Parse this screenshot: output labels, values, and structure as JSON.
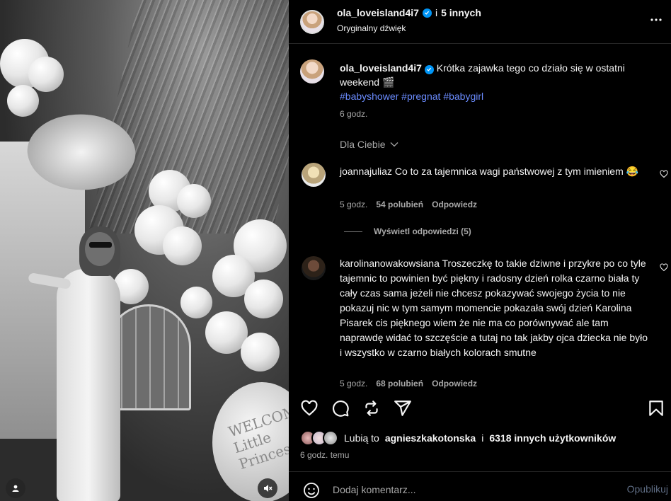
{
  "header": {
    "username": "ola_loveisland4i7",
    "collab_connector": "i",
    "collab_others": "5 innych",
    "audio": "Oryginalny dźwięk",
    "more_icon": "ellipsis-icon"
  },
  "caption": {
    "username": "ola_loveisland4i7",
    "text": "Krótka zajawka tego co działo się w ostatni weekend",
    "emoji": "🎬",
    "hashtags": "#babyshower #pregnat #babygirl",
    "time": "6 godz."
  },
  "filter": {
    "label": "Dla Ciebie"
  },
  "comments": [
    {
      "username": "joannajuliaz",
      "text": "Co to za tajemnica wagi państwowej z tym imieniem",
      "emoji": "😂",
      "time": "5 godz.",
      "likes": "54 polubień",
      "reply": "Odpowiedz"
    },
    {
      "username": "karolinanowakowsiana",
      "text": "Troszeczkę to takie dziwne i przykre po co tyle tajemnic to powinien być piękny i radosny dzień rolka czarno biała ty cały czas sama jeżeli nie chcesz pokazywać swojego życia to nie pokazuj nic w tym samym momencie pokazała swój dzień Karolina Pisarek cis pięknego wiem że nie ma co porównywać ale tam naprawdę widać to szczęście a tutaj no tak jakby ojca dziecka nie było i wszystko w czarno białych kolorach smutne",
      "time": "5 godz.",
      "likes": "68 polubień",
      "reply": "Odpowiedz"
    }
  ],
  "view_replies": "Wyświetl odpowiedzi (5)",
  "likes": {
    "prefix": "Lubią to",
    "user": "agnieszkakotonska",
    "connector": "i",
    "others": "6318 innych użytkowników"
  },
  "posted_time": "6 godz. temu",
  "add_comment": {
    "placeholder": "Dodaj komentarz...",
    "post_label": "Opublikuj"
  },
  "media": {
    "sign_text": "WELCOME Little Princess"
  },
  "colors": {
    "background": "#000000",
    "text": "#f5f5f5",
    "muted": "#a8a8a8",
    "hashtag": "#6b8cff",
    "verified": "#0095f6"
  }
}
